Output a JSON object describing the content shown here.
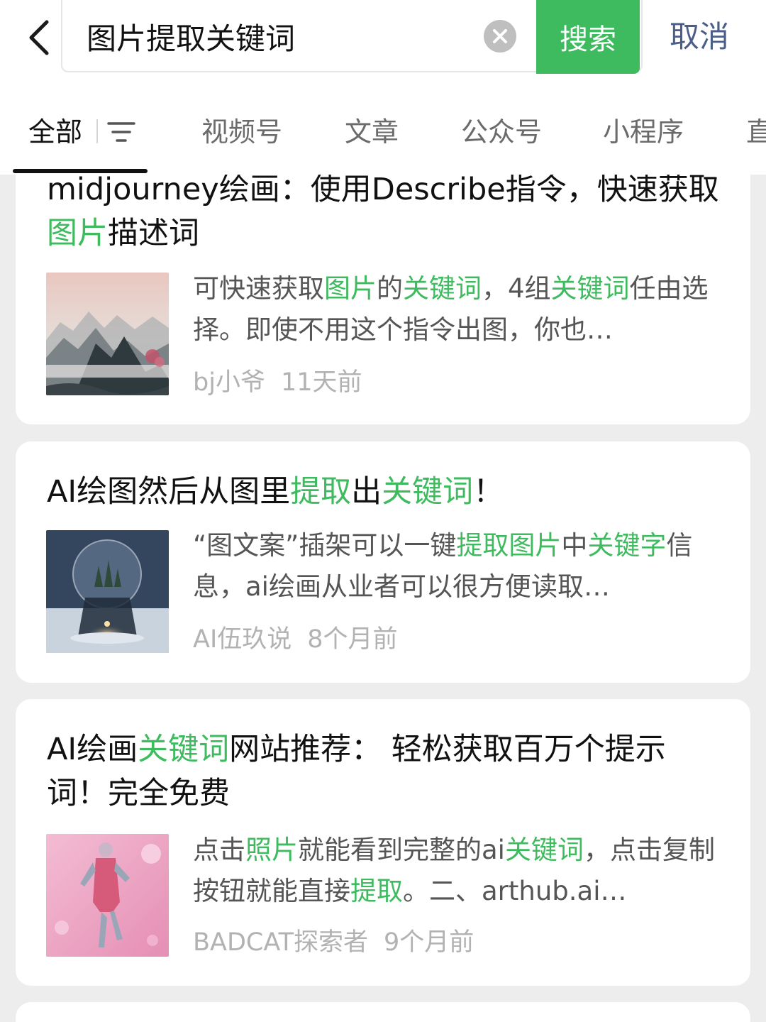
{
  "search": {
    "query": "图片提取关键词",
    "button_label": "搜索",
    "cancel_label": "取消"
  },
  "tabs": [
    {
      "label": "全部",
      "active": true
    },
    {
      "label": "视频号",
      "active": false
    },
    {
      "label": "文章",
      "active": false
    },
    {
      "label": "公众号",
      "active": false
    },
    {
      "label": "小程序",
      "active": false
    },
    {
      "label": "直",
      "active": false
    }
  ],
  "icons": {
    "back": "chevron-left-icon",
    "clear": "clear-circle-icon",
    "filter": "filter-icon"
  },
  "colors": {
    "accent": "#3fbb5f",
    "link": "#4a5e89",
    "meta": "#b2b2b2"
  },
  "results": [
    {
      "title_segments": [
        {
          "text": "midjourney绘画：使用Describe指令，快速获取",
          "hl": false
        },
        {
          "text": "图片",
          "hl": true
        },
        {
          "text": "描述词",
          "hl": false
        }
      ],
      "desc_segments": [
        {
          "text": "可快速获取",
          "hl": false
        },
        {
          "text": "图片",
          "hl": true
        },
        {
          "text": "的",
          "hl": false
        },
        {
          "text": "关键词",
          "hl": true
        },
        {
          "text": "，4组",
          "hl": false
        },
        {
          "text": "关键词",
          "hl": true
        },
        {
          "text": "任由选择。即使不用这个指令出图，你也…",
          "hl": false
        }
      ],
      "author": "bj小爷",
      "time": "11天前",
      "thumbnail": "chinese-ink-landscape-thumbnail"
    },
    {
      "title_segments": [
        {
          "text": "AI绘图然后从图里",
          "hl": false
        },
        {
          "text": "提取",
          "hl": true
        },
        {
          "text": "出",
          "hl": false
        },
        {
          "text": "关键词",
          "hl": true
        },
        {
          "text": "！",
          "hl": false
        }
      ],
      "desc_segments": [
        {
          "text": "“图文案”插架可以一键",
          "hl": false
        },
        {
          "text": "提取图片",
          "hl": true
        },
        {
          "text": "中",
          "hl": false
        },
        {
          "text": "关键字",
          "hl": true
        },
        {
          "text": "信息，ai绘画从业者可以很方便读取…",
          "hl": false
        }
      ],
      "author": "AI伍玖说",
      "time": "8个月前",
      "thumbnail": "snow-globe-thumbnail"
    },
    {
      "title_segments": [
        {
          "text": "AI绘画",
          "hl": false
        },
        {
          "text": "关键词",
          "hl": true
        },
        {
          "text": "网站推荐： 轻松获取百万个提示词！完全免费",
          "hl": false
        }
      ],
      "desc_segments": [
        {
          "text": "点击",
          "hl": false
        },
        {
          "text": "照片",
          "hl": true
        },
        {
          "text": "就能看到完整的ai",
          "hl": false
        },
        {
          "text": "关键词",
          "hl": true
        },
        {
          "text": "，点击复制按钮就能直接",
          "hl": false
        },
        {
          "text": "提取",
          "hl": true
        },
        {
          "text": "。二、arthub.ai…",
          "hl": false
        }
      ],
      "author": "BADCAT探索者",
      "time": "9个月前",
      "thumbnail": "pink-figure-thumbnail"
    }
  ]
}
